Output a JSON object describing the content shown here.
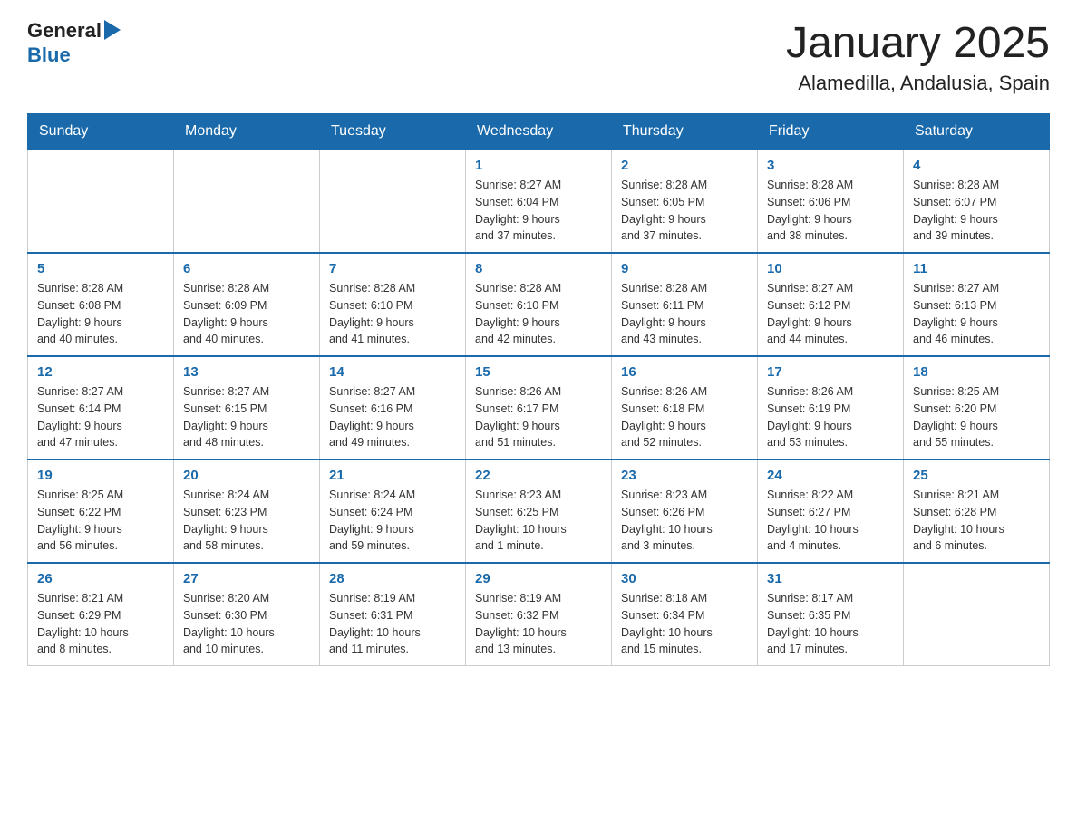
{
  "header": {
    "logo": {
      "general": "General",
      "blue": "Blue"
    },
    "title": "January 2025",
    "location": "Alamedilla, Andalusia, Spain"
  },
  "calendar": {
    "weekdays": [
      "Sunday",
      "Monday",
      "Tuesday",
      "Wednesday",
      "Thursday",
      "Friday",
      "Saturday"
    ],
    "weeks": [
      [
        {
          "day": "",
          "info": ""
        },
        {
          "day": "",
          "info": ""
        },
        {
          "day": "",
          "info": ""
        },
        {
          "day": "1",
          "info": "Sunrise: 8:27 AM\nSunset: 6:04 PM\nDaylight: 9 hours\nand 37 minutes."
        },
        {
          "day": "2",
          "info": "Sunrise: 8:28 AM\nSunset: 6:05 PM\nDaylight: 9 hours\nand 37 minutes."
        },
        {
          "day": "3",
          "info": "Sunrise: 8:28 AM\nSunset: 6:06 PM\nDaylight: 9 hours\nand 38 minutes."
        },
        {
          "day": "4",
          "info": "Sunrise: 8:28 AM\nSunset: 6:07 PM\nDaylight: 9 hours\nand 39 minutes."
        }
      ],
      [
        {
          "day": "5",
          "info": "Sunrise: 8:28 AM\nSunset: 6:08 PM\nDaylight: 9 hours\nand 40 minutes."
        },
        {
          "day": "6",
          "info": "Sunrise: 8:28 AM\nSunset: 6:09 PM\nDaylight: 9 hours\nand 40 minutes."
        },
        {
          "day": "7",
          "info": "Sunrise: 8:28 AM\nSunset: 6:10 PM\nDaylight: 9 hours\nand 41 minutes."
        },
        {
          "day": "8",
          "info": "Sunrise: 8:28 AM\nSunset: 6:10 PM\nDaylight: 9 hours\nand 42 minutes."
        },
        {
          "day": "9",
          "info": "Sunrise: 8:28 AM\nSunset: 6:11 PM\nDaylight: 9 hours\nand 43 minutes."
        },
        {
          "day": "10",
          "info": "Sunrise: 8:27 AM\nSunset: 6:12 PM\nDaylight: 9 hours\nand 44 minutes."
        },
        {
          "day": "11",
          "info": "Sunrise: 8:27 AM\nSunset: 6:13 PM\nDaylight: 9 hours\nand 46 minutes."
        }
      ],
      [
        {
          "day": "12",
          "info": "Sunrise: 8:27 AM\nSunset: 6:14 PM\nDaylight: 9 hours\nand 47 minutes."
        },
        {
          "day": "13",
          "info": "Sunrise: 8:27 AM\nSunset: 6:15 PM\nDaylight: 9 hours\nand 48 minutes."
        },
        {
          "day": "14",
          "info": "Sunrise: 8:27 AM\nSunset: 6:16 PM\nDaylight: 9 hours\nand 49 minutes."
        },
        {
          "day": "15",
          "info": "Sunrise: 8:26 AM\nSunset: 6:17 PM\nDaylight: 9 hours\nand 51 minutes."
        },
        {
          "day": "16",
          "info": "Sunrise: 8:26 AM\nSunset: 6:18 PM\nDaylight: 9 hours\nand 52 minutes."
        },
        {
          "day": "17",
          "info": "Sunrise: 8:26 AM\nSunset: 6:19 PM\nDaylight: 9 hours\nand 53 minutes."
        },
        {
          "day": "18",
          "info": "Sunrise: 8:25 AM\nSunset: 6:20 PM\nDaylight: 9 hours\nand 55 minutes."
        }
      ],
      [
        {
          "day": "19",
          "info": "Sunrise: 8:25 AM\nSunset: 6:22 PM\nDaylight: 9 hours\nand 56 minutes."
        },
        {
          "day": "20",
          "info": "Sunrise: 8:24 AM\nSunset: 6:23 PM\nDaylight: 9 hours\nand 58 minutes."
        },
        {
          "day": "21",
          "info": "Sunrise: 8:24 AM\nSunset: 6:24 PM\nDaylight: 9 hours\nand 59 minutes."
        },
        {
          "day": "22",
          "info": "Sunrise: 8:23 AM\nSunset: 6:25 PM\nDaylight: 10 hours\nand 1 minute."
        },
        {
          "day": "23",
          "info": "Sunrise: 8:23 AM\nSunset: 6:26 PM\nDaylight: 10 hours\nand 3 minutes."
        },
        {
          "day": "24",
          "info": "Sunrise: 8:22 AM\nSunset: 6:27 PM\nDaylight: 10 hours\nand 4 minutes."
        },
        {
          "day": "25",
          "info": "Sunrise: 8:21 AM\nSunset: 6:28 PM\nDaylight: 10 hours\nand 6 minutes."
        }
      ],
      [
        {
          "day": "26",
          "info": "Sunrise: 8:21 AM\nSunset: 6:29 PM\nDaylight: 10 hours\nand 8 minutes."
        },
        {
          "day": "27",
          "info": "Sunrise: 8:20 AM\nSunset: 6:30 PM\nDaylight: 10 hours\nand 10 minutes."
        },
        {
          "day": "28",
          "info": "Sunrise: 8:19 AM\nSunset: 6:31 PM\nDaylight: 10 hours\nand 11 minutes."
        },
        {
          "day": "29",
          "info": "Sunrise: 8:19 AM\nSunset: 6:32 PM\nDaylight: 10 hours\nand 13 minutes."
        },
        {
          "day": "30",
          "info": "Sunrise: 8:18 AM\nSunset: 6:34 PM\nDaylight: 10 hours\nand 15 minutes."
        },
        {
          "day": "31",
          "info": "Sunrise: 8:17 AM\nSunset: 6:35 PM\nDaylight: 10 hours\nand 17 minutes."
        },
        {
          "day": "",
          "info": ""
        }
      ]
    ]
  }
}
